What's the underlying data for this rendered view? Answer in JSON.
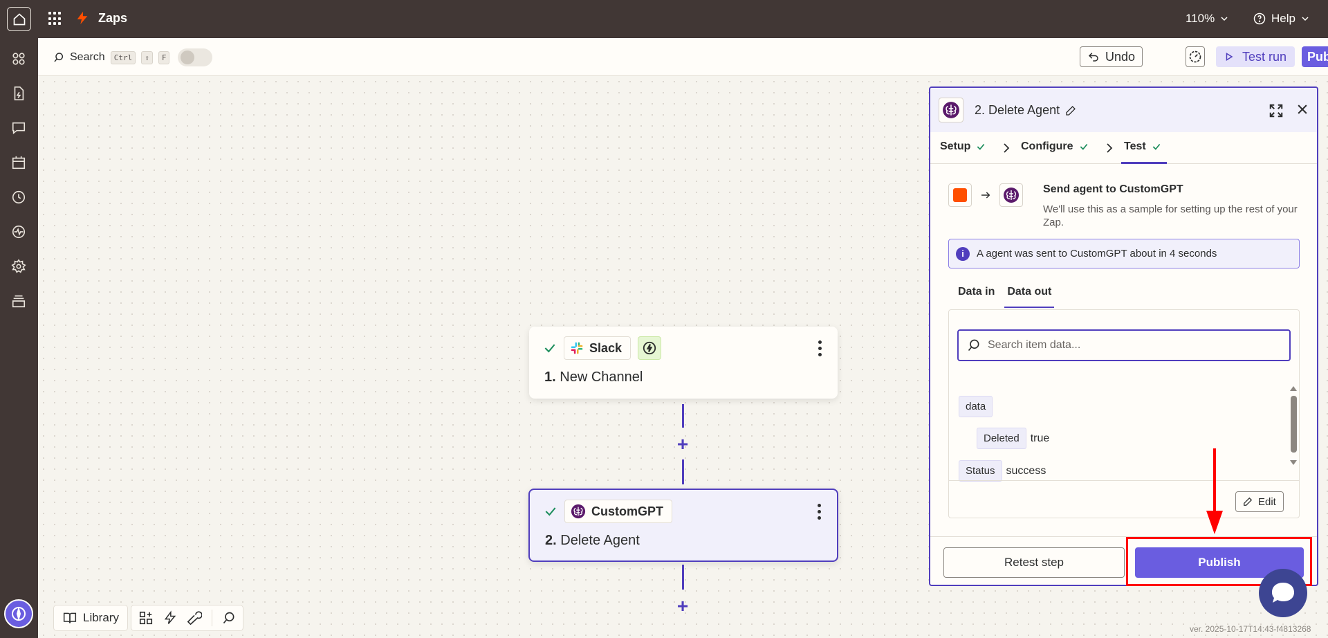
{
  "topbar": {
    "title": "Zaps",
    "zoom": "110%",
    "help": "Help"
  },
  "toolbar": {
    "search_label": "Search",
    "shortcut_ctrl": "Ctrl",
    "shortcut_shift": "⇧",
    "shortcut_f": "F",
    "undo_label": "Undo",
    "test_run_label": "Test run",
    "publish_label": "Publish"
  },
  "nodes": [
    {
      "app": "Slack",
      "number": "1.",
      "title": "New Channel"
    },
    {
      "app": "CustomGPT",
      "number": "2.",
      "title": "Delete Agent"
    }
  ],
  "bottom_tools": {
    "library_label": "Library"
  },
  "panel": {
    "title": "2. Delete Agent",
    "steps": [
      {
        "label": "Setup"
      },
      {
        "label": "Configure"
      },
      {
        "label": "Test"
      }
    ],
    "send_title": "Send agent to CustomGPT",
    "send_desc": "We'll use this as a sample for setting up the rest of your Zap.",
    "info_text": "A agent was sent to CustomGPT about in 4 seconds",
    "data_tabs": [
      "Data in",
      "Data out"
    ],
    "search_placeholder": "Search item data...",
    "tree": {
      "root_key": "data",
      "deleted_key": "Deleted",
      "deleted_value": "true",
      "status_key": "Status",
      "status_value": "success"
    },
    "edit_label": "Edit",
    "retest_label": "Retest step",
    "publish_label": "Publish"
  },
  "version": "ver. 2025-10-17T14:43-f4813268",
  "colors": {
    "topbar_bg": "#413735",
    "accent": "#503ebd",
    "publish": "#6a5de0",
    "success": "#1c8d5c",
    "zapier_orange": "#ff4f00",
    "annotation": "#ff0000"
  }
}
